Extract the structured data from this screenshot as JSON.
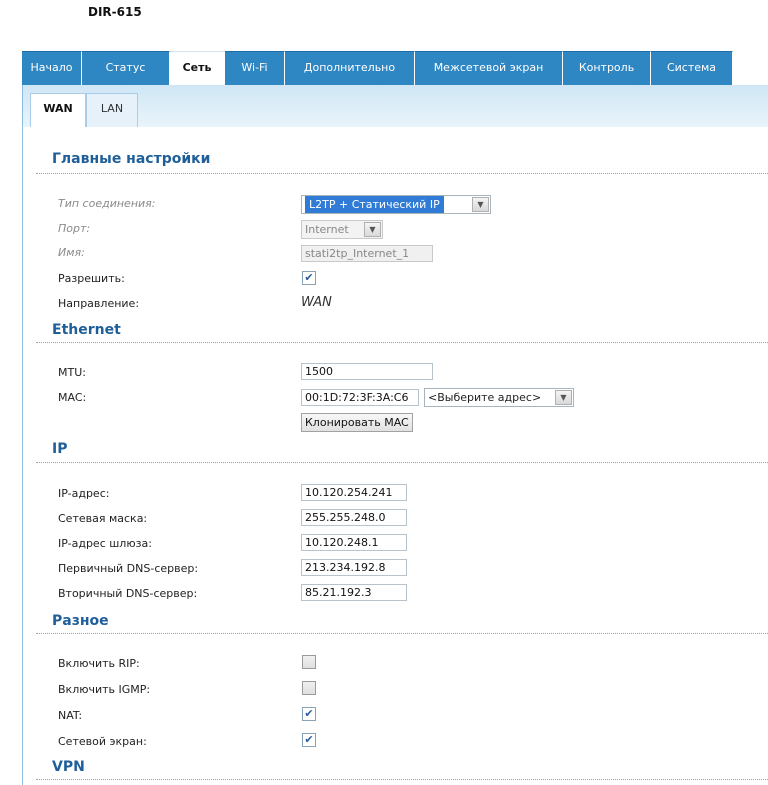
{
  "header": {
    "model": "DIR-615"
  },
  "nav": {
    "tabs": [
      {
        "label": "Начало",
        "active": false
      },
      {
        "label": "Статус",
        "active": false
      },
      {
        "label": "Сеть",
        "active": true
      },
      {
        "label": "Wi-Fi",
        "active": false
      },
      {
        "label": "Дополнительно",
        "active": false
      },
      {
        "label": "Межсетевой экран",
        "active": false
      },
      {
        "label": "Контроль",
        "active": false
      },
      {
        "label": "Система",
        "active": false
      }
    ]
  },
  "subtabs": [
    {
      "label": "WAN",
      "active": true
    },
    {
      "label": "LAN",
      "active": false
    }
  ],
  "main": {
    "title": "Главные настройки",
    "connection_type_label": "Тип соединения:",
    "connection_type_value": "L2TP + Статический IP",
    "port_label": "Порт:",
    "port_value": "Internet",
    "name_label": "Имя:",
    "name_value": "stati2tp_Internet_1",
    "enable_label": "Разрешить:",
    "enable_checked": true,
    "direction_label": "Направление:",
    "direction_value": "WAN"
  },
  "ethernet": {
    "title": "Ethernet",
    "mtu_label": "MTU:",
    "mtu_value": "1500",
    "mac_label": "MAC:",
    "mac_value": "00:1D:72:3F:3A:C6",
    "mac_select": "<Выберите адрес>",
    "clone_mac": "Клонировать MAC"
  },
  "ip": {
    "title": "IP",
    "ip_label": "IP-адрес:",
    "ip_value": "10.120.254.241",
    "mask_label": "Сетевая маска:",
    "mask_value": "255.255.248.0",
    "gateway_label": "IP-адрес шлюза:",
    "gateway_value": "10.120.248.1",
    "dns1_label": "Первичный DNS-сервер:",
    "dns1_value": "213.234.192.8",
    "dns2_label": "Вторичный DNS-сервер:",
    "dns2_value": "85.21.192.3"
  },
  "misc": {
    "title": "Разное",
    "rip_label": "Включить RIP:",
    "rip_checked": false,
    "igmp_label": "Включить IGMP:",
    "igmp_checked": false,
    "nat_label": "NAT:",
    "nat_checked": true,
    "firewall_label": "Сетевой экран:",
    "firewall_checked": true
  },
  "vpn": {
    "title": "VPN"
  },
  "icons": {
    "check": "checkmark-icon",
    "dropdown": "dropdown-arrow-icon"
  },
  "colors": {
    "nav_blue": "#2e86c3",
    "section_blue": "#1f5f99",
    "select_highlight": "#2f7bd6"
  }
}
